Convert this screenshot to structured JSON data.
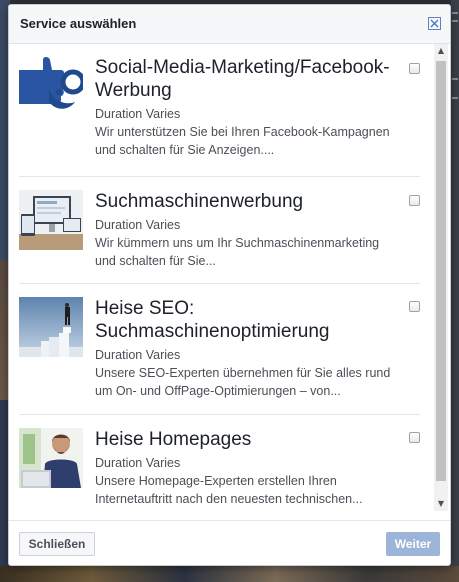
{
  "dialog": {
    "title": "Service auswählen",
    "close_icon": "close-x-icon"
  },
  "services": [
    {
      "name": "Social-Media-Marketing/Facebook-Werbung",
      "duration": "Duration Varies",
      "description": "Wir unterstützen Sie bei Ihren Facebook-Kampagnen und schalten für Sie Anzeigen....",
      "image": "social-media-logo",
      "checked": false
    },
    {
      "name": "Suchmaschinenwerbung",
      "duration": "Duration Varies",
      "description": "Wir kümmern uns um Ihr Suchmaschinenmarketing und schalten für Sie...",
      "image": "devices-screens",
      "checked": false
    },
    {
      "name": "Heise SEO: Suchmaschinenoptimierung",
      "duration": "Duration Varies",
      "description": "Unsere SEO-Experten übernehmen für Sie alles rund um On- und OffPage-Optimierungen – von...",
      "image": "man-on-ladder-sky",
      "checked": false
    },
    {
      "name": "Heise Homepages",
      "duration": "Duration Varies",
      "description": "Unsere Homepage-Experten erstellen Ihren Internetauftritt nach den neuesten technischen...",
      "image": "man-with-laptop",
      "checked": false
    }
  ],
  "footer": {
    "close_label": "Schließen",
    "next_label": "Weiter"
  },
  "colors": {
    "next_button": "#9cb4d8",
    "accent": "#4267b2"
  }
}
